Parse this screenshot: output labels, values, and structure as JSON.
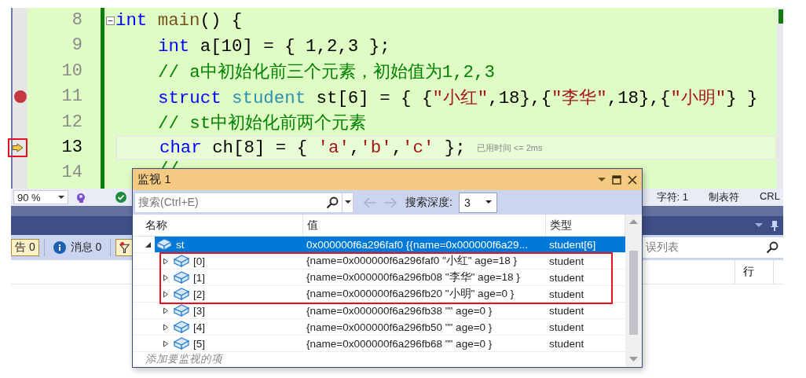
{
  "editor": {
    "lines": [
      {
        "number": "8",
        "breakpoint": false,
        "current": false,
        "highlighted": false,
        "foldable": true,
        "tokens": [
          {
            "kind": "keyword",
            "text": "int "
          },
          {
            "kind": "function",
            "text": "main"
          },
          {
            "kind": "plain",
            "text": "() {"
          }
        ],
        "children": [
          {
            "number": "9",
            "breakpoint": false,
            "current": false,
            "highlighted": false,
            "foldable": false,
            "tokens": [
              {
                "kind": "keyword",
                "text": "int"
              },
              {
                "kind": "plain",
                "text": " a[10] = { 1,2,3 };"
              }
            ]
          },
          {
            "number": "10",
            "breakpoint": false,
            "current": false,
            "highlighted": false,
            "foldable": false,
            "tokens": [
              {
                "kind": "comment",
                "text": "// a中初始化前三个元素，初始值为1,2,3"
              }
            ]
          },
          {
            "number": "11",
            "breakpoint": true,
            "current": false,
            "highlighted": false,
            "foldable": false,
            "tokens": [
              {
                "kind": "keyword",
                "text": "struct "
              },
              {
                "kind": "type",
                "text": "student"
              },
              {
                "kind": "plain",
                "text": " st[6] = { {"
              },
              {
                "kind": "string",
                "text": "\"小红\""
              },
              {
                "kind": "plain",
                "text": ",18},{"
              },
              {
                "kind": "string",
                "text": "\"李华\""
              },
              {
                "kind": "plain",
                "text": ",18},{"
              },
              {
                "kind": "string",
                "text": "\"小明\""
              },
              {
                "kind": "plain",
                "text": "} }"
              }
            ]
          },
          {
            "number": "12",
            "breakpoint": false,
            "current": false,
            "highlighted": false,
            "foldable": false,
            "tokens": [
              {
                "kind": "comment",
                "text": "// st中初始化前两个元素"
              }
            ]
          },
          {
            "number": "13",
            "breakpoint": false,
            "current": true,
            "highlighted": true,
            "foldable": false,
            "hint": "已用时间 <= 2ms",
            "tokens": [
              {
                "kind": "keyword",
                "text": "char"
              },
              {
                "kind": "plain",
                "text": " ch[8] = { "
              },
              {
                "kind": "string",
                "text": "'a'"
              },
              {
                "kind": "plain",
                "text": ","
              },
              {
                "kind": "string",
                "text": "'b'"
              },
              {
                "kind": "plain",
                "text": ","
              },
              {
                "kind": "string",
                "text": "'c'"
              },
              {
                "kind": "plain",
                "text": " };"
              }
            ]
          },
          {
            "number": "14",
            "breakpoint": false,
            "current": false,
            "highlighted": false,
            "foldable": false,
            "tokens": [
              {
                "kind": "comment",
                "text": "//"
              }
            ]
          }
        ]
      }
    ]
  },
  "status_bar": {
    "zoom": "90 %",
    "position": "字符: 1",
    "indent": "制表符",
    "line_ending": "CRL"
  },
  "error_list": {
    "filters": [
      {
        "kind": "warning",
        "label": "告 0",
        "on": true
      },
      {
        "kind": "message",
        "label": "消息 0",
        "on": false
      }
    ],
    "filter_button": {
      "on": true
    },
    "search": {
      "placeholder": "误列表"
    },
    "columns": [
      "行"
    ]
  },
  "watch": {
    "title": "监视 1",
    "search": {
      "placeholder": "搜索(Ctrl+E)"
    },
    "depth_label": "搜索深度:",
    "depth": "3",
    "columns": [
      "名称",
      "值",
      "类型"
    ],
    "items": [
      {
        "name": "st",
        "value": "0x000000f6a296faf0 {{name=0x000000f6a29...",
        "type": "student[6]",
        "expanded": true,
        "selected": true,
        "highlighted": false,
        "children": [
          {
            "name": "[0]",
            "value": "{name=0x000000f6a296faf0 \"小红\" age=18 }",
            "type": "student",
            "expanded": false,
            "selected": false,
            "highlighted": true
          },
          {
            "name": "[1]",
            "value": "{name=0x000000f6a296fb08 \"李华\" age=18 }",
            "type": "student",
            "expanded": false,
            "selected": false,
            "highlighted": true
          },
          {
            "name": "[2]",
            "value": "{name=0x000000f6a296fb20 \"小明\" age=0 }",
            "type": "student",
            "expanded": false,
            "selected": false,
            "highlighted": true
          },
          {
            "name": "[3]",
            "value": "{name=0x000000f6a296fb38 \"\" age=0 }",
            "type": "student",
            "expanded": false,
            "selected": false,
            "highlighted": false
          },
          {
            "name": "[4]",
            "value": "{name=0x000000f6a296fb50 \"\" age=0 }",
            "type": "student",
            "expanded": false,
            "selected": false,
            "highlighted": false
          },
          {
            "name": "[5]",
            "value": "{name=0x000000f6a296fb68 \"\" age=0 }",
            "type": "student",
            "expanded": false,
            "selected": false,
            "highlighted": false
          }
        ]
      }
    ],
    "add_placeholder": "添加要监视的项"
  }
}
